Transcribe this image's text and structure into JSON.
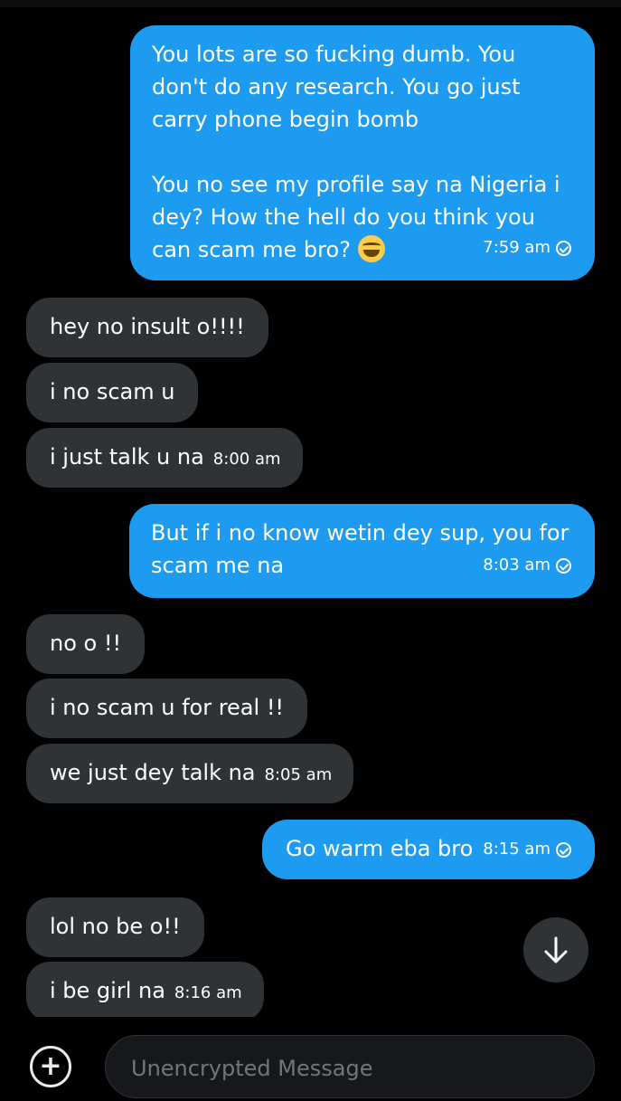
{
  "messages": [
    {
      "text": "You lots are so fucking dumb. You\ndon't do any research. You go just\ncarry phone begin bomb\n\nYou no see my profile say na Nigeria i\ndey? How the hell do you think you\ncan scam me bro? ",
      "emoji": "😂",
      "time": "7:59 am"
    },
    {
      "text": "hey no insult o!!!!"
    },
    {
      "text": "i no scam u"
    },
    {
      "text": "i just talk u na",
      "time": "8:00 am"
    },
    {
      "text": "But if i no know wetin dey sup, you for\nscam me na",
      "time": "8:03 am"
    },
    {
      "text": "no o !!"
    },
    {
      "text": "i no scam u for real !!"
    },
    {
      "text": "we just dey talk na",
      "time": "8:05 am"
    },
    {
      "text": "Go warm eba bro",
      "time": "8:15 am"
    },
    {
      "text": "lol no be o!!"
    },
    {
      "text": "i be girl na",
      "time": "8:16 am"
    }
  ],
  "composer": {
    "placeholder": "Unencrypted Message",
    "add_icon": "plus-circle-icon"
  },
  "scroll_icon": "arrow-down-icon",
  "colors": {
    "sent": "#1d9bf0",
    "received": "#2f3336",
    "background": "#000000"
  }
}
